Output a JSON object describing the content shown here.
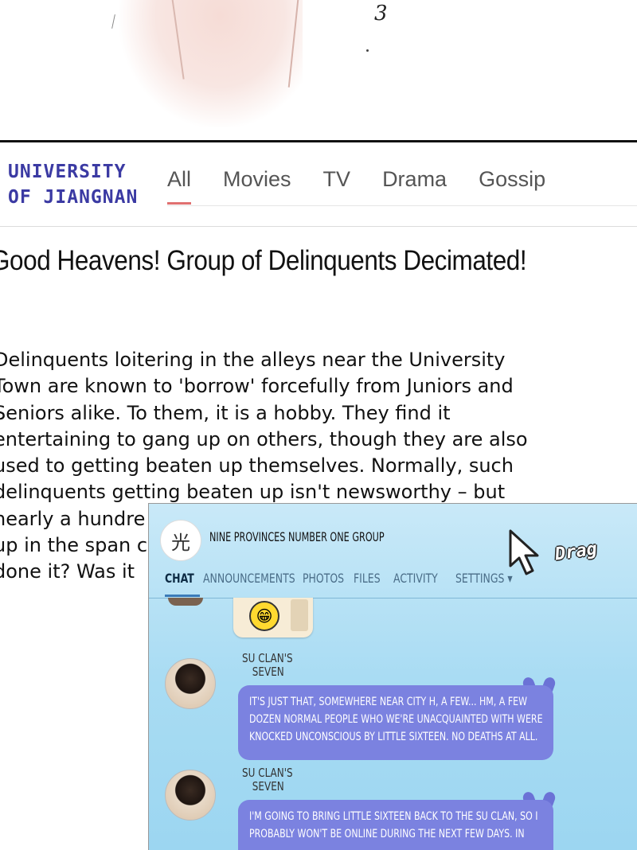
{
  "art": {
    "mark": "3"
  },
  "news": {
    "logo": {
      "line1": "UNIVERSITY",
      "line2": "OF JIANGNAN"
    },
    "tabs": [
      {
        "label": "All",
        "active": true
      },
      {
        "label": "Movies",
        "active": false
      },
      {
        "label": "TV",
        "active": false
      },
      {
        "label": "Drama",
        "active": false
      },
      {
        "label": "Gossip",
        "active": false
      }
    ],
    "headline": "Good Heavens! Group of Delinquents Decimated!",
    "article_lines": [
      "Delinquents loitering in the alleys near the University",
      "Town are known to 'borrow' forcefully from Juniors and",
      "Seniors alike. To them, it is a hobby. They find it",
      "entertaining to gang up on others, though they are also",
      "used to getting beaten up themselves. Normally, such",
      "delinquents getting beaten up isn't newsworthy  – but",
      "nearly a hundre",
      "up in the span c",
      "done it? Was it"
    ]
  },
  "chat": {
    "group_avatar_glyph": "光",
    "title": "NINE PROVINCES NUMBER ONE GROUP",
    "drag_label": "Drag",
    "tabs": [
      {
        "label": "CHAT",
        "active": true
      },
      {
        "label": "ANNOUNCEMENTS",
        "active": false
      },
      {
        "label": "PHOTOS",
        "active": false
      },
      {
        "label": "FILES",
        "active": false
      },
      {
        "label": "ACTIVITY",
        "active": false
      },
      {
        "label": "SETTINGS ▾",
        "active": false
      }
    ],
    "messages": [
      {
        "sender_line1": "SU CLAN'S",
        "sender_line2": "SEVEN",
        "lines": [
          "IT'S JUST THAT, SOMEWHERE NEAR CITY H, A FEW... HM, A FEW",
          "DOZEN NORMAL PEOPLE WHO WE'RE UNACQUAINTED WITH WERE",
          "KNOCKED UNCONSCIOUS BY LITTLE SIXTEEN. NO DEATHS AT ALL."
        ]
      },
      {
        "sender_line1": "SU CLAN'S",
        "sender_line2": "SEVEN",
        "lines": [
          "I'M GOING TO BRING LITTLE SIXTEEN BACK TO THE SU CLAN, SO I",
          "PROBABLY WON'T BE ONLINE DURING THE NEXT FEW DAYS. IN"
        ]
      }
    ]
  }
}
